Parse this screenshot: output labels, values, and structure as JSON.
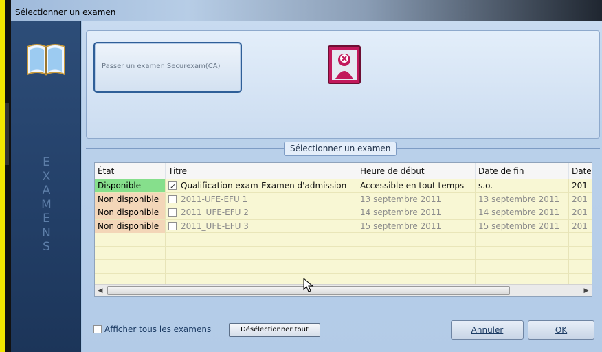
{
  "window": {
    "title": "Sélectionner un examen"
  },
  "sidebar": {
    "word": [
      "E",
      "X",
      "A",
      "M",
      "E",
      "N",
      "S"
    ]
  },
  "top_panel": {
    "exam_button_label": "Passer un examen Securexam(CA)"
  },
  "group": {
    "title": "Sélectionner un examen"
  },
  "grid": {
    "columns": [
      "État",
      "Titre",
      "Heure de début",
      "Date de fin",
      "Date"
    ],
    "rows": [
      {
        "state": "Disponible",
        "title": "Qualification exam-Examen d'admission",
        "start": "Accessible en tout temps",
        "end": "s.o.",
        "date": "201",
        "checked": true,
        "available": true
      },
      {
        "state": "Non disponible",
        "title": "2011-UFE-EFU 1",
        "start": "13 septembre 2011",
        "end": "13 septembre 2011",
        "date": "201",
        "checked": false,
        "available": false
      },
      {
        "state": "Non disponible",
        "title": "2011_UFE-EFU 2",
        "start": "14 septembre 2011",
        "end": "14 septembre 2011",
        "date": "201",
        "checked": false,
        "available": false
      },
      {
        "state": "Non disponible",
        "title": "2011_UFE-EFU 3",
        "start": "15 septembre 2011",
        "end": "15 septembre 2011",
        "date": "201",
        "checked": false,
        "available": false
      }
    ]
  },
  "footer": {
    "show_all_label": "Afficher tous les examens",
    "deselect_label": "Désélectionner tout",
    "cancel_label": "Annuler",
    "ok_label": "OK"
  },
  "colors": {
    "available": "#86df8c",
    "unavailable": "#f3d6b8",
    "grid_bg": "#f8f7d4",
    "sidebar": "#24416a"
  }
}
